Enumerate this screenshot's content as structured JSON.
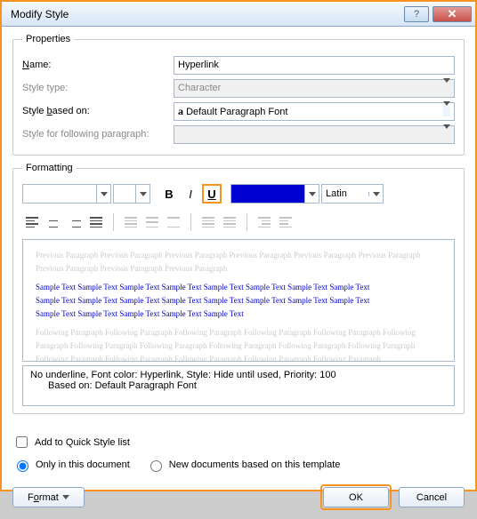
{
  "title": "Modify Style",
  "properties": {
    "legend": "Properties",
    "name_label": "Name:",
    "name_value": "Hyperlink",
    "type_label": "Style type:",
    "type_value": "Character",
    "basedon_label": "Style based on:",
    "basedon_value": "Default Paragraph Font",
    "basedon_prefix": "a",
    "following_label": "Style for following paragraph:",
    "following_value": ""
  },
  "formatting": {
    "legend": "Formatting",
    "lang": "Latin"
  },
  "preview": {
    "ghost_prev": "Previous Paragraph Previous Paragraph Previous Paragraph Previous Paragraph Previous Paragraph Previous Paragraph Previous Paragraph Previous Paragraph Previous Paragraph",
    "sample1": "Sample Text Sample Text Sample Text Sample Text Sample Text Sample Text Sample Text Sample Text",
    "sample2": "Sample Text Sample Text Sample Text Sample Text Sample Text Sample Text Sample Text Sample Text",
    "sample3": "Sample Text Sample Text Sample Text Sample Text Sample Text",
    "ghost_next": "Following Paragraph Following Paragraph Following Paragraph Following Paragraph Following Paragraph Following Paragraph Following Paragraph Following Paragraph Following Paragraph Following Paragraph Following Paragraph Following Paragraph Following Paragraph Following Paragraph Following Paragraph Following Paragraph"
  },
  "description": {
    "line1": "No underline, Font color: Hyperlink, Style: Hide until used, Priority: 100",
    "line2": "Based on: Default Paragraph Font"
  },
  "footer": {
    "quickstyle": "Add to Quick Style list",
    "only_doc": "Only in this document",
    "new_docs": "New documents based on this template",
    "format": "Format",
    "ok": "OK",
    "cancel": "Cancel"
  }
}
